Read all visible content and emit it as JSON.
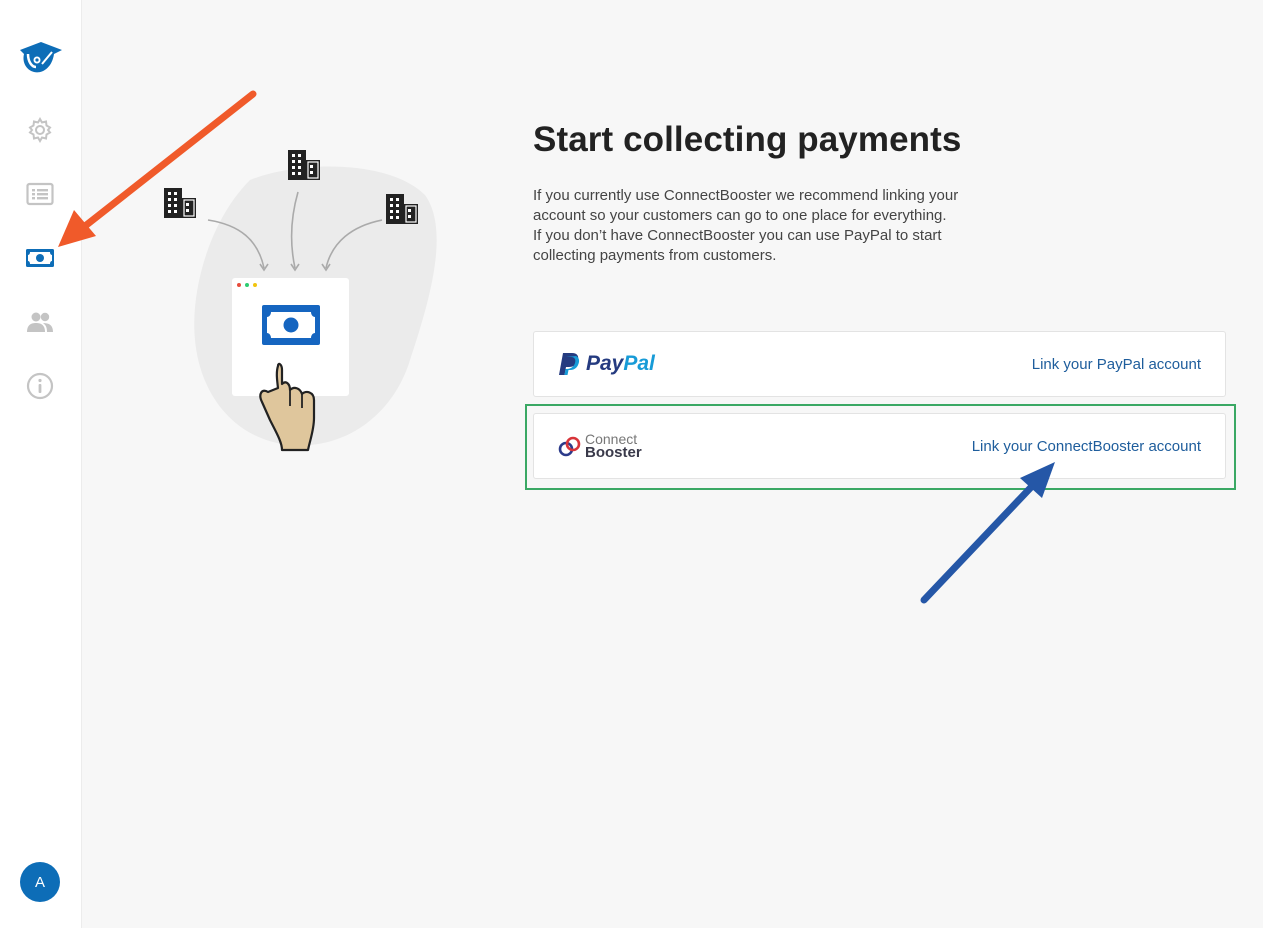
{
  "sidebar": {
    "items": [
      {
        "icon": "gear-icon"
      },
      {
        "icon": "list-icon"
      },
      {
        "icon": "money-icon",
        "active": true
      },
      {
        "icon": "people-icon"
      },
      {
        "icon": "info-icon"
      }
    ],
    "avatar_initial": "A"
  },
  "main": {
    "title": "Start collecting payments",
    "description_lines": [
      "If you currently use ConnectBooster we recommend linking your",
      "account so your customers can go to one place for everything.",
      "If you don’t have ConnectBooster you can use PayPal to start",
      "collecting payments from customers."
    ],
    "providers": [
      {
        "logo_pay": "Pay",
        "logo_pal": "Pal",
        "link_label": "Link your PayPal account"
      },
      {
        "logo_line1": "Connect",
        "logo_line2": "Booster",
        "link_label": "Link your ConnectBooster account"
      }
    ]
  },
  "colors": {
    "accent": "#0d6db7",
    "link": "#1e5d9c",
    "highlight": "#3aa864",
    "annotation_arrow_1": "#f05a2a",
    "annotation_arrow_2": "#2557a7"
  }
}
